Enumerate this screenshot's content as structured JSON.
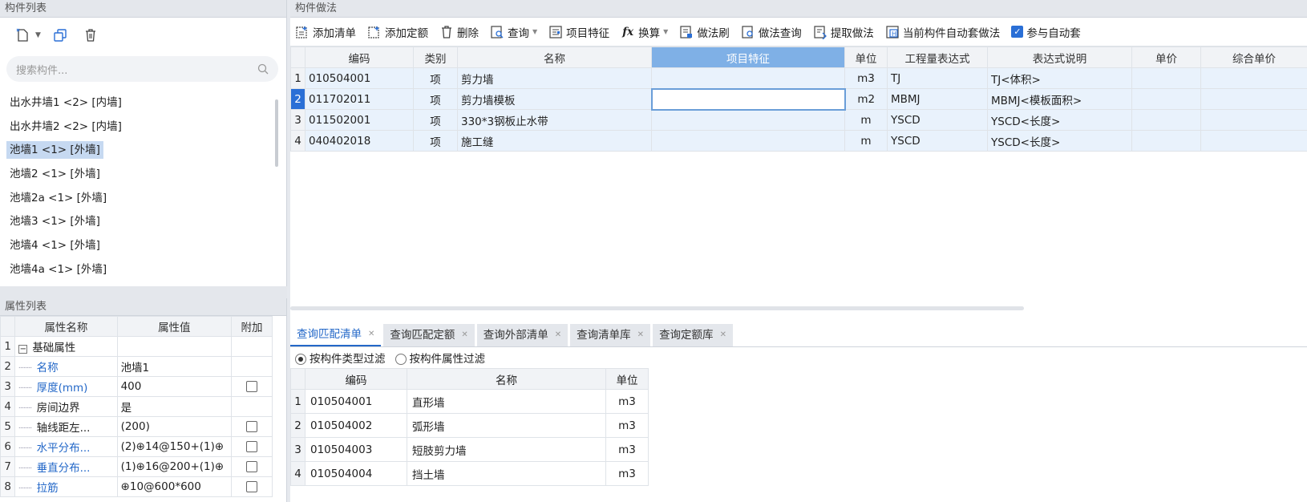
{
  "left_panel": {
    "title": "构件列表",
    "search_placeholder": "搜索构件...",
    "items": [
      {
        "label": "出水井墙1 <2> [内墙]"
      },
      {
        "label": "出水井墙2 <2> [内墙]"
      },
      {
        "label": "池墙1 <1> [外墙]",
        "selected": true
      },
      {
        "label": "池墙2 <1> [外墙]"
      },
      {
        "label": "池墙2a <1> [外墙]"
      },
      {
        "label": "池墙3 <1> [外墙]"
      },
      {
        "label": "池墙4 <1> [外墙]"
      },
      {
        "label": "池墙4a <1> [外墙]"
      }
    ]
  },
  "properties": {
    "title": "属性列表",
    "headers": [
      "属性名称",
      "属性值",
      "附加"
    ],
    "rows": [
      {
        "n": "1",
        "name": "基础属性",
        "value": "",
        "group": true
      },
      {
        "n": "2",
        "name": "名称",
        "value": "池墙1",
        "blue": true,
        "check": false
      },
      {
        "n": "3",
        "name": "厚度(mm)",
        "value": "400",
        "blue": true,
        "check": true
      },
      {
        "n": "4",
        "name": "房间边界",
        "value": "是",
        "blue": false,
        "check": false
      },
      {
        "n": "5",
        "name": "轴线距左...",
        "value": "(200)",
        "blue": false,
        "check": true
      },
      {
        "n": "6",
        "name": "水平分布...",
        "value": "(2)⊕14@150+(1)⊕",
        "blue": true,
        "check": true
      },
      {
        "n": "7",
        "name": "垂直分布...",
        "value": "(1)⊕16@200+(1)⊕",
        "blue": true,
        "check": true
      },
      {
        "n": "8",
        "name": "拉筋",
        "value": "⊕10@600*600",
        "blue": true,
        "check": true
      }
    ]
  },
  "right_panel": {
    "title": "构件做法",
    "toolbar": [
      {
        "label": "添加清单",
        "icon": "add-list-icon"
      },
      {
        "label": "添加定额",
        "icon": "add-quota-icon"
      },
      {
        "label": "删除",
        "icon": "trash-icon"
      },
      {
        "label": "查询",
        "icon": "query-icon",
        "dropdown": true
      },
      {
        "label": "项目特征",
        "icon": "feature-icon"
      },
      {
        "label": "换算",
        "icon": "fx-icon",
        "dropdown": true
      },
      {
        "label": "做法刷",
        "icon": "brush-icon"
      },
      {
        "label": "做法查询",
        "icon": "method-query-icon"
      },
      {
        "label": "提取做法",
        "icon": "extract-icon"
      },
      {
        "label": "当前构件自动套做法",
        "icon": "auto-apply-icon"
      },
      {
        "label": "参与自动套",
        "icon": "checkbox-icon",
        "checked": true
      }
    ],
    "columns": [
      "编码",
      "类别",
      "名称",
      "项目特征",
      "单位",
      "工程量表达式",
      "表达式说明",
      "单价",
      "综合单价"
    ],
    "rows": [
      {
        "n": "1",
        "code": "010504001",
        "type": "项",
        "name": "剪力墙",
        "feature": "",
        "unit": "m3",
        "expr": "TJ",
        "desc": "TJ<体积>",
        "price": "",
        "total": ""
      },
      {
        "n": "2",
        "code": "011702011",
        "type": "项",
        "name": "剪力墙模板",
        "feature": "",
        "unit": "m2",
        "expr": "MBMJ",
        "desc": "MBMJ<模板面积>",
        "price": "",
        "total": ""
      },
      {
        "n": "3",
        "code": "011502001",
        "type": "项",
        "name": "330*3钢板止水带",
        "feature": "",
        "unit": "m",
        "expr": "YSCD",
        "desc": "YSCD<长度>",
        "price": "",
        "total": ""
      },
      {
        "n": "4",
        "code": "040402018",
        "type": "项",
        "name": "施工缝",
        "feature": "",
        "unit": "m",
        "expr": "YSCD",
        "desc": "YSCD<长度>",
        "price": "",
        "total": ""
      }
    ],
    "tabs": [
      {
        "label": "查询匹配清单",
        "active": true
      },
      {
        "label": "查询匹配定额"
      },
      {
        "label": "查询外部清单"
      },
      {
        "label": "查询清单库"
      },
      {
        "label": "查询定额库"
      }
    ],
    "filter": {
      "by_type": "按构件类型过滤",
      "by_attr": "按构件属性过滤"
    },
    "sub_columns": [
      "编码",
      "名称",
      "单位"
    ],
    "sub_rows": [
      {
        "n": "1",
        "code": "010504001",
        "name": "直形墙",
        "unit": "m3"
      },
      {
        "n": "2",
        "code": "010504002",
        "name": "弧形墙",
        "unit": "m3"
      },
      {
        "n": "3",
        "code": "010504003",
        "name": "短肢剪力墙",
        "unit": "m3"
      },
      {
        "n": "4",
        "code": "010504004",
        "name": "挡土墙",
        "unit": "m3"
      }
    ]
  }
}
